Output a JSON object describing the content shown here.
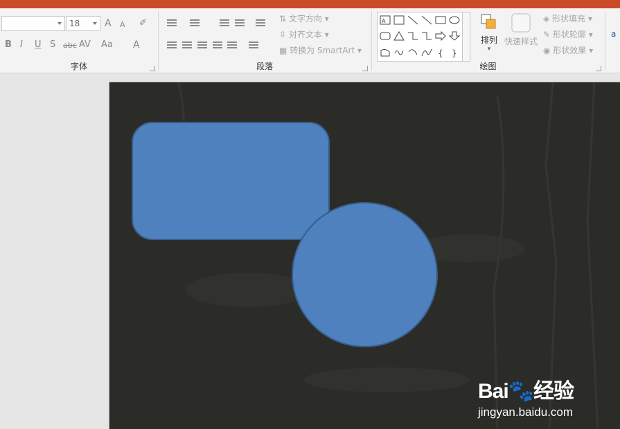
{
  "ribbon": {
    "font_group": {
      "label": "字体",
      "font_name": "",
      "font_size": "18",
      "buttons": {
        "grow": "A",
        "shrink": "A",
        "bold": "B",
        "italic": "I",
        "underline": "U",
        "shadow": "S",
        "strike": "abc",
        "spacing": "AV",
        "case": "Aa",
        "color": "A"
      }
    },
    "paragraph_group": {
      "label": "段落",
      "text_direction": "文字方向",
      "align_text": "对齐文本",
      "convert_smartart": "转换为 SmartArt"
    },
    "drawing_group": {
      "label": "绘图",
      "arrange": "排列",
      "quick_styles": "快速样式",
      "shape_fill": "形状填充",
      "shape_outline": "形状轮廓",
      "shape_effects": "形状效果"
    }
  },
  "slide": {
    "background": "#2b2b28"
  },
  "shapes": {
    "fill_color": "#4e81bd",
    "border_color": "#385d8a"
  },
  "watermark": {
    "logo": "Bai🐾经验",
    "url": "jingyan.baidu.com"
  }
}
